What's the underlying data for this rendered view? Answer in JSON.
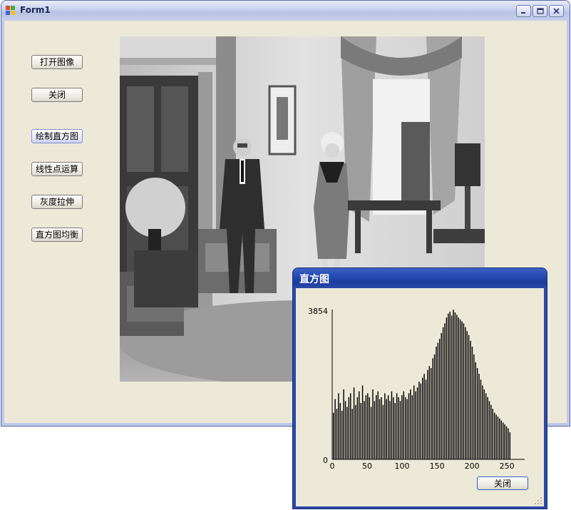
{
  "main_window": {
    "title": "Form1",
    "buttons": {
      "open_image": "打开图像",
      "close": "关闭",
      "draw_histogram": "绘制直方图",
      "linear_point_op": "线性点运算",
      "gray_stretch": "灰度拉伸",
      "histogram_equalize": "直方图均衡"
    }
  },
  "histogram_dialog": {
    "title": "直方图",
    "close_label": "关闭",
    "chart_data": {
      "type": "bar",
      "x_ticks": [
        "0",
        "50",
        "100",
        "150",
        "200",
        "250"
      ],
      "y_ticks": [
        "0",
        "3854"
      ],
      "xlim": [
        0,
        255
      ],
      "ylim": [
        0,
        3854
      ],
      "values": [
        1200,
        1550,
        1300,
        1700,
        1450,
        1250,
        1800,
        1500,
        1350,
        1600,
        1700,
        1300,
        1850,
        1400,
        1600,
        1750,
        1450,
        1900,
        1500,
        1650,
        1700,
        1600,
        1350,
        1800,
        1500,
        1650,
        1750,
        1550,
        1600,
        1400,
        1700,
        1550,
        1650,
        1500,
        1750,
        1600,
        1450,
        1700,
        1600,
        1500,
        1650,
        1750,
        1600,
        1550,
        1700,
        1800,
        1650,
        1900,
        1750,
        1850,
        2000,
        1950,
        2100,
        2200,
        2050,
        2300,
        2400,
        2350,
        2600,
        2700,
        2900,
        3000,
        3100,
        3250,
        3400,
        3500,
        3650,
        3750,
        3800,
        3700,
        3850,
        3780,
        3720,
        3650,
        3600,
        3550,
        3500,
        3400,
        3300,
        3200,
        3050,
        2900,
        2700,
        2500,
        2350,
        2200,
        2050,
        1900,
        1800,
        1700,
        1600,
        1500,
        1400,
        1300,
        1200,
        1150,
        1100,
        1050,
        1000,
        950,
        900,
        850,
        800,
        700
      ]
    }
  }
}
